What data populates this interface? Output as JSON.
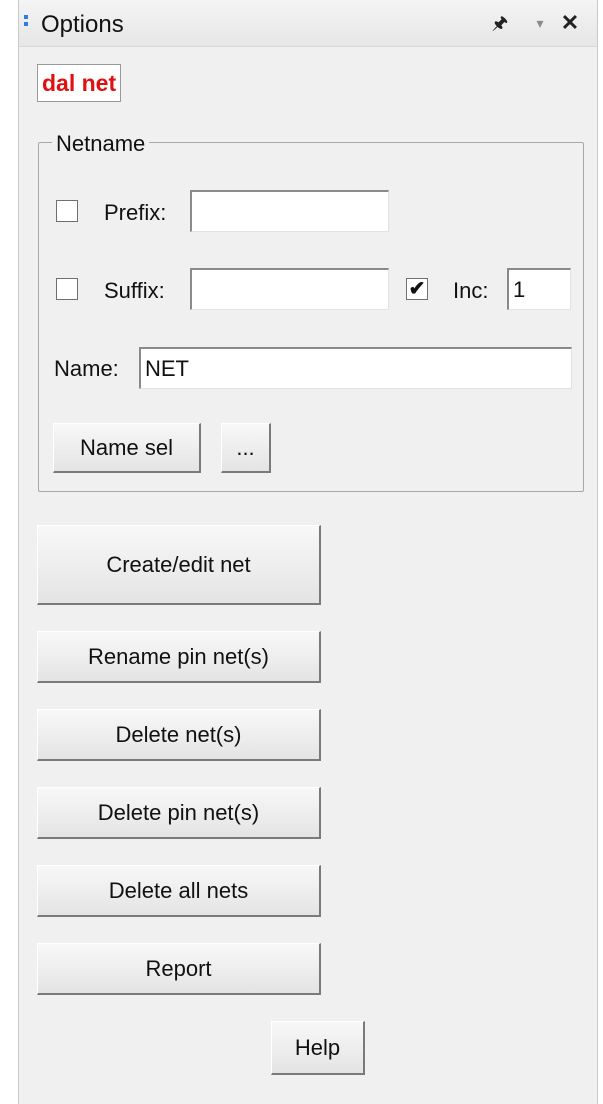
{
  "window": {
    "title": "Options",
    "icons": {
      "pin": "pin-icon",
      "dropdown": "dropdown-icon",
      "close": "close-icon"
    }
  },
  "mode_label": "dal net",
  "netname_group": {
    "legend": "Netname",
    "prefix": {
      "label": "Prefix:",
      "checked": false,
      "value": ""
    },
    "suffix": {
      "label": "Suffix:",
      "checked": false,
      "value": ""
    },
    "inc": {
      "label": "Inc:",
      "checked": true,
      "value": "1"
    },
    "name": {
      "label": "Name:",
      "value": "NET"
    },
    "name_sel_button": "Name sel",
    "browse_button": "..."
  },
  "actions": {
    "create_edit": "Create/edit net",
    "rename_pin": "Rename pin net(s)",
    "delete_nets": "Delete net(s)",
    "delete_pin": "Delete pin net(s)",
    "delete_all": "Delete all nets",
    "report": "Report",
    "help": "Help"
  },
  "colors": {
    "mode_label": "#e01010",
    "grip": "#2f7de1",
    "panel_bg": "#f0f0f0"
  }
}
